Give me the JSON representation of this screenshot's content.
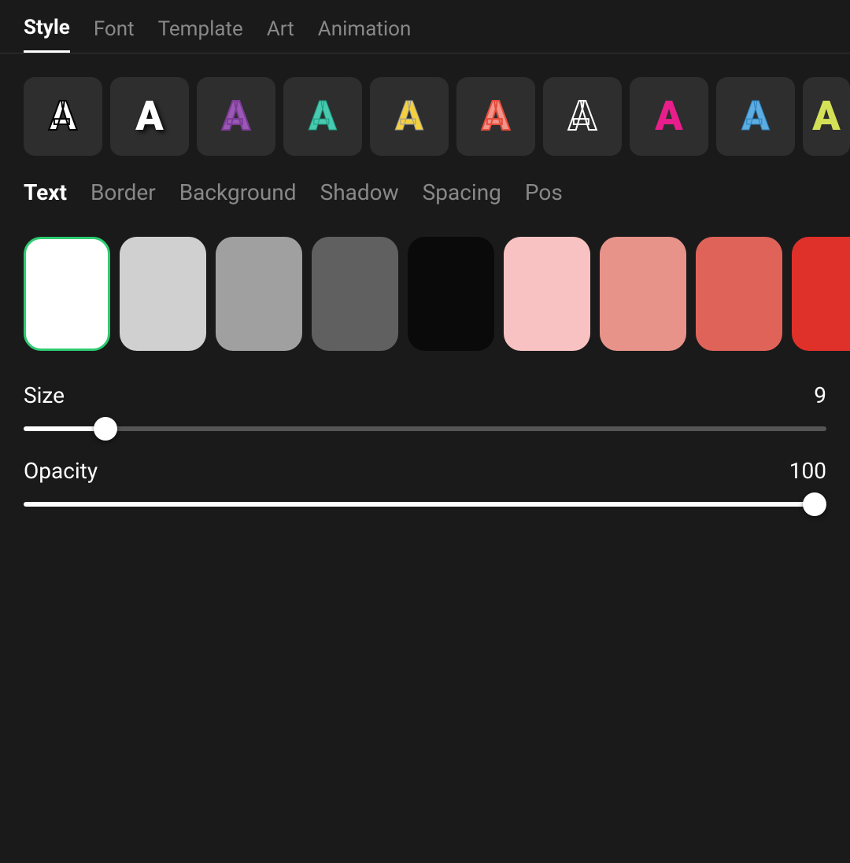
{
  "topNav": {
    "items": [
      {
        "id": "style",
        "label": "Style",
        "active": true
      },
      {
        "id": "font",
        "label": "Font",
        "active": false
      },
      {
        "id": "template",
        "label": "Template",
        "active": false
      },
      {
        "id": "art",
        "label": "Art",
        "active": false
      },
      {
        "id": "animation",
        "label": "Animation",
        "active": false
      }
    ]
  },
  "fontStyles": [
    {
      "id": "fs1",
      "letter": "A",
      "style": "white-solid",
      "bg": "#2e2e2e"
    },
    {
      "id": "fs2",
      "letter": "A",
      "style": "white-shadow",
      "bg": "#2e2e2e"
    },
    {
      "id": "fs3",
      "letter": "A",
      "style": "purple",
      "bg": "#2e2e2e"
    },
    {
      "id": "fs4",
      "letter": "A",
      "style": "teal",
      "bg": "#2e2e2e"
    },
    {
      "id": "fs5",
      "letter": "A",
      "style": "yellow",
      "bg": "#2e2e2e"
    },
    {
      "id": "fs6",
      "letter": "A",
      "style": "pink-outline",
      "bg": "#2e2e2e"
    },
    {
      "id": "fs7",
      "letter": "A",
      "style": "white-border",
      "bg": "#2e2e2e"
    },
    {
      "id": "fs8",
      "letter": "A",
      "style": "hot-pink",
      "bg": "#2e2e2e"
    },
    {
      "id": "fs9",
      "letter": "A",
      "style": "blue",
      "bg": "#2e2e2e"
    },
    {
      "id": "fs10",
      "letter": "A",
      "style": "yellow-green",
      "bg": "#2e2e2e"
    }
  ],
  "subNav": {
    "items": [
      {
        "id": "text",
        "label": "Text",
        "active": true
      },
      {
        "id": "border",
        "label": "Border",
        "active": false
      },
      {
        "id": "background",
        "label": "Background",
        "active": false
      },
      {
        "id": "shadow",
        "label": "Shadow",
        "active": false
      },
      {
        "id": "spacing",
        "label": "Spacing",
        "active": false
      },
      {
        "id": "position",
        "label": "Pos",
        "active": false
      }
    ]
  },
  "colorSwatches": [
    {
      "id": "sw1",
      "color": "#ffffff",
      "selected": true
    },
    {
      "id": "sw2",
      "color": "#d0d0d0",
      "selected": false
    },
    {
      "id": "sw3",
      "color": "#a0a0a0",
      "selected": false
    },
    {
      "id": "sw4",
      "color": "#606060",
      "selected": false
    },
    {
      "id": "sw5",
      "color": "#0a0a0a",
      "selected": false
    },
    {
      "id": "sw6",
      "color": "#f9c2c2",
      "selected": false
    },
    {
      "id": "sw7",
      "color": "#e8938a",
      "selected": false
    },
    {
      "id": "sw8",
      "color": "#e0635a",
      "selected": false
    },
    {
      "id": "sw9",
      "color": "#e0302a",
      "selected": false
    }
  ],
  "sliders": {
    "size": {
      "label": "Size",
      "value": 9,
      "min": 0,
      "max": 100,
      "percent": 10
    },
    "opacity": {
      "label": "Opacity",
      "value": 100,
      "min": 0,
      "max": 100,
      "percent": 100
    }
  }
}
